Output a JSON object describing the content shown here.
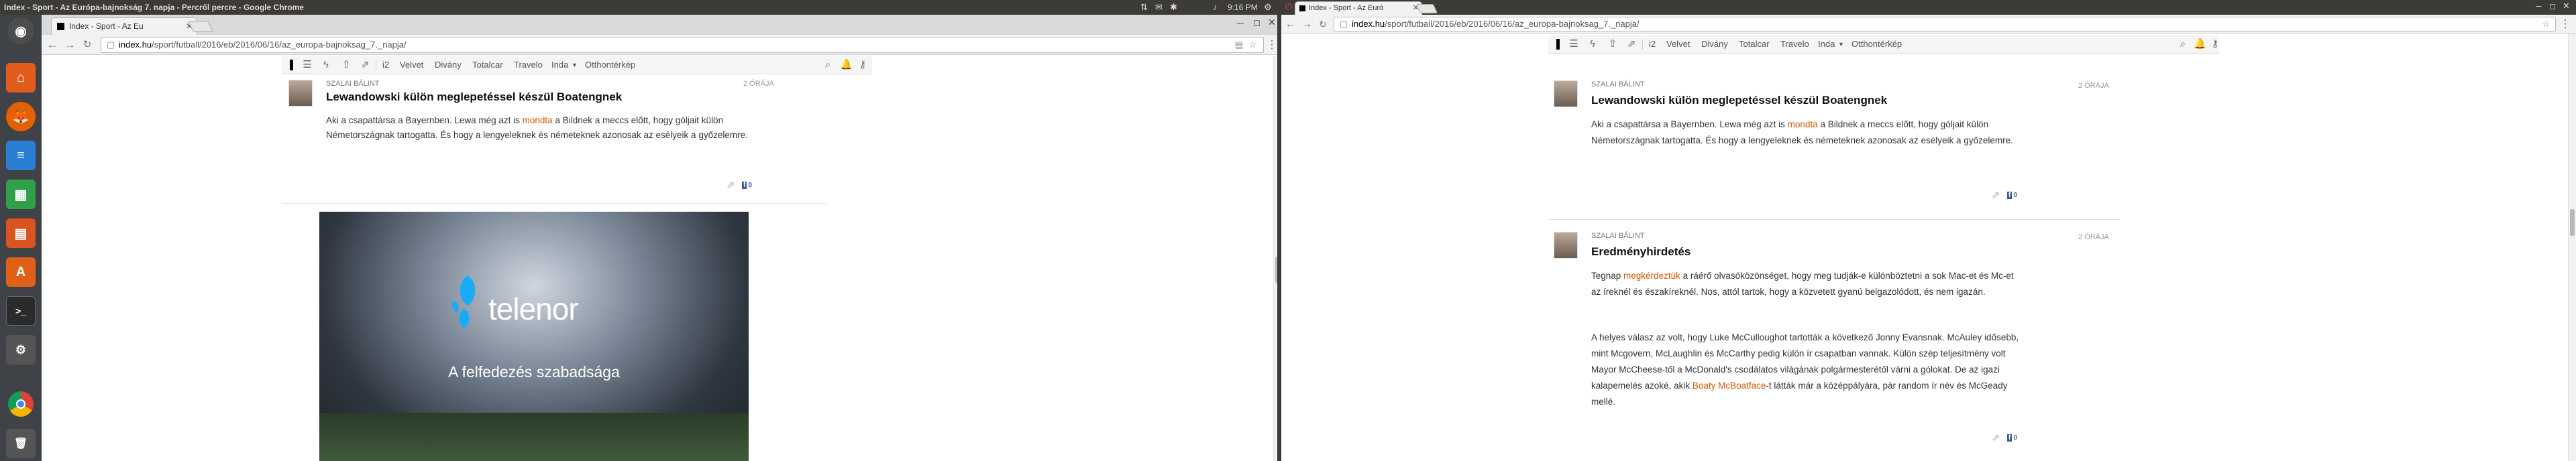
{
  "left_screen": {
    "system": {
      "window_title": "Index - Sport - Az Európa-bajnokság 7. napja - Percről percre - Google Chrome",
      "time": "9:16 PM"
    },
    "browser": {
      "tab_title": "Index - Sport - Az Eu",
      "url_domain": "index.hu",
      "url_path": "/sport/futball/2016/eb/2016/06/16/az_europa-bajnoksag_7._napja/"
    },
    "nav": {
      "items": [
        "i2",
        "Velvet",
        "Divány",
        "Totalcar",
        "Travelo",
        "Inda",
        "Otthontérkép"
      ]
    },
    "post": {
      "author": "SZALAI BÁLINT",
      "time": "2 ÓRÁJA",
      "title": "Lewandowski külön meglepetéssel készül Boatengnek",
      "body_before": "Aki a csapattársa a Bayernben. Lewa még azt is ",
      "body_link": "mondta",
      "body_after": " a Bildnek a meccs előtt, hogy góljait külön Németországnak tartogatta. És hogy a lengyeleknek és németeknek azonosak az esélyeik a győzelemre.",
      "fb_count": "0"
    },
    "ad": {
      "brand": "telenor",
      "tagline": "A felfedezés szabadsága"
    }
  },
  "right_screen": {
    "browser": {
      "tab_title": "Index - Sport - Az Euró",
      "url_domain": "index.hu",
      "url_path": "/sport/futball/2016/eb/2016/06/16/az_europa-bajnoksag_7._napja/"
    },
    "nav": {
      "items": [
        "i2",
        "Velvet",
        "Divány",
        "Totalcar",
        "Travelo",
        "Inda",
        "Otthontérkép"
      ]
    },
    "post1": {
      "author": "SZALAI BÁLINT",
      "time": "2 ÓRÁJA",
      "title": "Lewandowski külön meglepetéssel készül Boatengnek",
      "body_before": "Aki a csapattársa a Bayernben. Lewa még azt is ",
      "body_link": "mondta",
      "body_after": " a Bildnek a meccs előtt, hogy góljait külön Németországnak tartogatta. És hogy a lengyeleknek és németeknek azonosak az esélyeik a győzelemre.",
      "fb_count": "0"
    },
    "post2": {
      "author": "SZALAI BÁLINT",
      "time": "2 ÓRÁJA",
      "title": "Eredményhirdetés",
      "p1_before": "Tegnap ",
      "p1_link": "megkérdeztük",
      "p1_after": " a ráérő olvasóközönséget, hogy meg tudják-e különböztetni a sok Mac-et és Mc-et az íreknél és északíreknél. Nos, attól tartok, hogy a közvetett gyanú beigazolódott, és nem igazán.",
      "p2_before": "A helyes válasz az volt, hogy Luke McCulloughot tartották a következő Jonny Evansnak. McAuley idősebb, mint Mcgovern, McLaughlin és McCarthy pedig külön ír csapatban vannak. Külön szép teljesítmény volt Mayor McCheese-től a McDonald's csodálatos világának polgármesterétől várni a gólokat. De az igazi kalapemelés azoké, akik ",
      "p2_link": "Boaty McBoatface",
      "p2_after": "-t látták már a középpályára, pár random ír név és McGeady mellé.",
      "fb_count": "0"
    }
  },
  "colors": {
    "link": "#d35400",
    "unity_bar": "#3c3b37",
    "launcher": "#3f4348"
  }
}
